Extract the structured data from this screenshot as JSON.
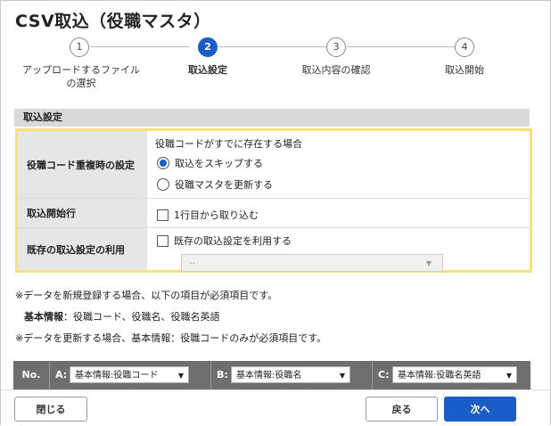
{
  "dialog": {
    "title": "CSV取込（役職マスタ）"
  },
  "stepper": {
    "steps": [
      {
        "num": "1",
        "label": "アップロードするファイル\nの選択",
        "active": false
      },
      {
        "num": "2",
        "label": "取込設定",
        "active": true
      },
      {
        "num": "3",
        "label": "取込内容の確認",
        "active": false
      },
      {
        "num": "4",
        "label": "取込開始",
        "active": false
      }
    ]
  },
  "section": {
    "title": "取込設定"
  },
  "settings": {
    "duplicate": {
      "label": "役職コード重複時の設定",
      "description": "役職コードがすでに存在する場合",
      "options": [
        "取込をスキップする",
        "役職マスタを更新する"
      ],
      "selected": 0
    },
    "start_row": {
      "label": "取込開始行",
      "checkbox_label": "1行目から取り込む",
      "checked": false
    },
    "existing": {
      "label": "既存の取込設定の利用",
      "checkbox_label": "既存の取込設定を利用する",
      "checked": false,
      "select_value": "--"
    }
  },
  "notes": {
    "line1": "※データを新規登録する場合、以下の項目が必須項目です。",
    "line2_bold": "基本情報",
    "line2_rest": "：役職コード、役職名、役職名英語",
    "line3": "※データを更新する場合、基本情報：役職コードのみが必須項目です。"
  },
  "mapping": {
    "no_label": "No.",
    "columns": [
      {
        "key": "A:",
        "value": "基本情報:役職コード"
      },
      {
        "key": "B:",
        "value": "基本情報:役職名"
      },
      {
        "key": "C:",
        "value": "基本情報:役職名英語"
      }
    ]
  },
  "footer": {
    "close_label": "閉じる",
    "back_label": "戻る",
    "next_label": "次へ"
  },
  "colors": {
    "primary": "#1a5dc8",
    "highlight_border": "#f6e27a",
    "header_gray": "#d9d9d9",
    "map_bar": "#6e6e6e"
  }
}
